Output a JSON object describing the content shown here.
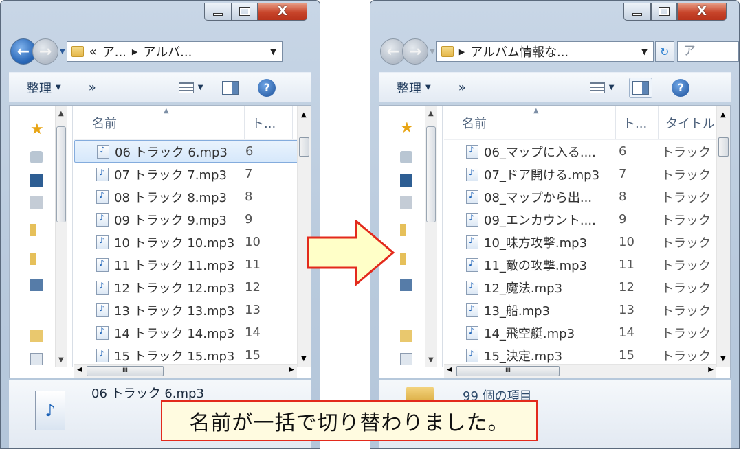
{
  "left_window": {
    "address_prefix": "«",
    "breadcrumb": [
      "ア...",
      "アルバ..."
    ],
    "toolbar": {
      "organize_label": "整理",
      "more_label": "»"
    },
    "columns": {
      "name": "名前",
      "track": "ト..."
    },
    "rows": [
      {
        "name": "06 トラック 6.mp3",
        "track": "6",
        "selected": true
      },
      {
        "name": "07 トラック 7.mp3",
        "track": "7"
      },
      {
        "name": "08 トラック 8.mp3",
        "track": "8"
      },
      {
        "name": "09 トラック 9.mp3",
        "track": "9"
      },
      {
        "name": "10 トラック 10.mp3",
        "track": "10"
      },
      {
        "name": "11 トラック 11.mp3",
        "track": "11"
      },
      {
        "name": "12 トラック 12.mp3",
        "track": "12"
      },
      {
        "name": "13 トラック 13.mp3",
        "track": "13"
      },
      {
        "name": "14 トラック 14.mp3",
        "track": "14"
      },
      {
        "name": "15 トラック 15.mp3",
        "track": "15"
      }
    ],
    "details": {
      "file_name": "06 トラック 6.mp3"
    }
  },
  "right_window": {
    "breadcrumb": [
      "アルバム情報な..."
    ],
    "search_placeholder": "ア",
    "toolbar": {
      "organize_label": "整理",
      "more_label": "»"
    },
    "columns": {
      "name": "名前",
      "track": "ト...",
      "title": "タイトル"
    },
    "rows": [
      {
        "name": "06_マップに入る....",
        "track": "6",
        "title": "トラック"
      },
      {
        "name": "07_ドア開ける.mp3",
        "track": "7",
        "title": "トラック"
      },
      {
        "name": "08_マップから出...",
        "track": "8",
        "title": "トラック"
      },
      {
        "name": "09_エンカウント....",
        "track": "9",
        "title": "トラック"
      },
      {
        "name": "10_味方攻撃.mp3",
        "track": "10",
        "title": "トラック"
      },
      {
        "name": "11_敵の攻撃.mp3",
        "track": "11",
        "title": "トラック"
      },
      {
        "name": "12_魔法.mp3",
        "track": "12",
        "title": "トラック"
      },
      {
        "name": "13_船.mp3",
        "track": "13",
        "title": "トラック"
      },
      {
        "name": "14_飛空艇.mp3",
        "track": "14",
        "title": "トラック"
      },
      {
        "name": "15_決定.mp3",
        "track": "15",
        "title": "トラック"
      }
    ],
    "details": {
      "item_count": "99 個の項目"
    }
  },
  "caption": "名前が一括で切り替わりました。",
  "colors": {
    "arrow_fill": "#ffffc8",
    "arrow_stroke": "#e32a1c",
    "caption_border": "#e32a1c"
  }
}
